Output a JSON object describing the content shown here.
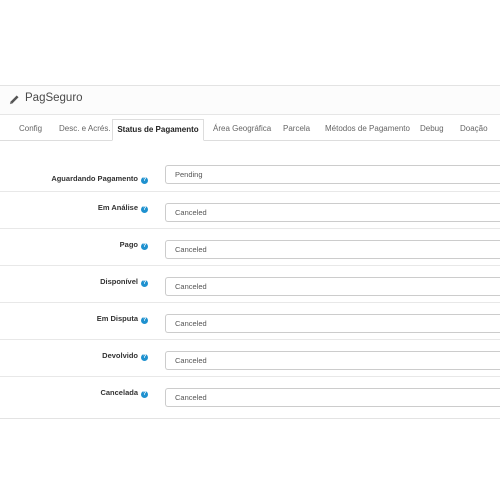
{
  "panel": {
    "title": "PagSeguro"
  },
  "tabs": [
    {
      "label": "Config"
    },
    {
      "label": "Desc. e Acrés."
    },
    {
      "label": "Status de Pagamento"
    },
    {
      "label": "Área Geográfica"
    },
    {
      "label": "Parcela"
    },
    {
      "label": "Métodos de Pagamento"
    },
    {
      "label": "Debug"
    },
    {
      "label": "Doação"
    }
  ],
  "active_tab": "Status de Pagamento",
  "status_fields": [
    {
      "label": "Aguardando Pagamento",
      "value": "Pending"
    },
    {
      "label": "Em Análise",
      "value": "Canceled"
    },
    {
      "label": "Pago",
      "value": "Canceled"
    },
    {
      "label": "Disponível",
      "value": "Canceled"
    },
    {
      "label": "Em Disputa",
      "value": "Canceled"
    },
    {
      "label": "Devolvido",
      "value": "Canceled"
    },
    {
      "label": "Cancelada",
      "value": "Canceled"
    }
  ],
  "icons": {
    "heading": "pencil-icon",
    "help": "question-circle-icon"
  },
  "colors": {
    "help_icon": "#1e91cf",
    "border": "#cccccc",
    "text": "#333333"
  }
}
